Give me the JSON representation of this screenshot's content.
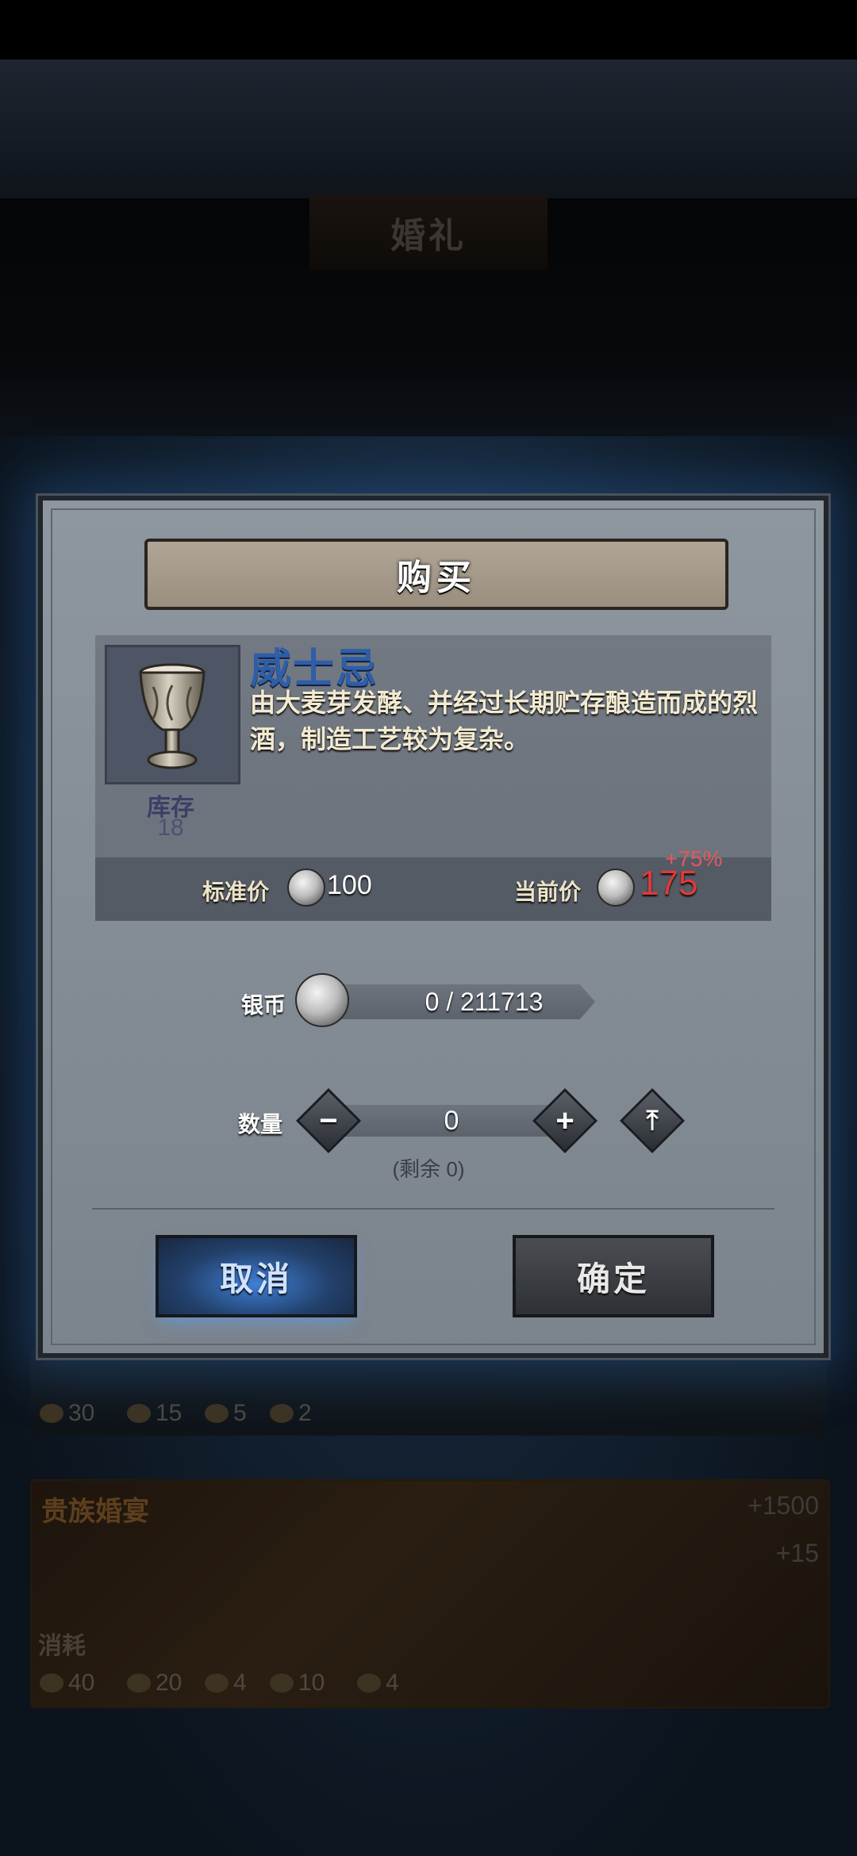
{
  "background": {
    "screen_title": "婚礼",
    "card1_stats": [
      "30",
      "15",
      "5",
      "2"
    ],
    "card2": {
      "title": "贵族婚宴",
      "reward1": "+1500",
      "reward2": "+15",
      "consume_label": "消耗",
      "stats": [
        "40",
        "20",
        "4",
        "10",
        "4"
      ]
    }
  },
  "dialog": {
    "title": "购买",
    "item": {
      "name": "威士忌",
      "description": "由大麦芽发酵、并经过长期贮存酿造而成的烈酒，制造工艺较为复杂。",
      "stock_label": "库存",
      "stock_value": "18",
      "icon": "goblet-icon"
    },
    "price": {
      "standard_label": "标准价",
      "standard_value": "100",
      "current_label": "当前价",
      "current_value": "175",
      "delta": "+75%"
    },
    "silver": {
      "label": "银币",
      "value": "0 / 211713",
      "icon": "silver-coin-icon"
    },
    "quantity": {
      "label": "数量",
      "value": "0",
      "remaining": "(剩余 0)",
      "minus_glyph": "−",
      "plus_glyph": "+",
      "max_glyph": "⤒"
    },
    "cancel_label": "取消",
    "confirm_label": "确定"
  },
  "colors": {
    "dialog_bg": "#858d96",
    "item_name": "#2e5ea8",
    "current_price": "#e03a3a",
    "cancel_button": "#3f7fd6"
  }
}
